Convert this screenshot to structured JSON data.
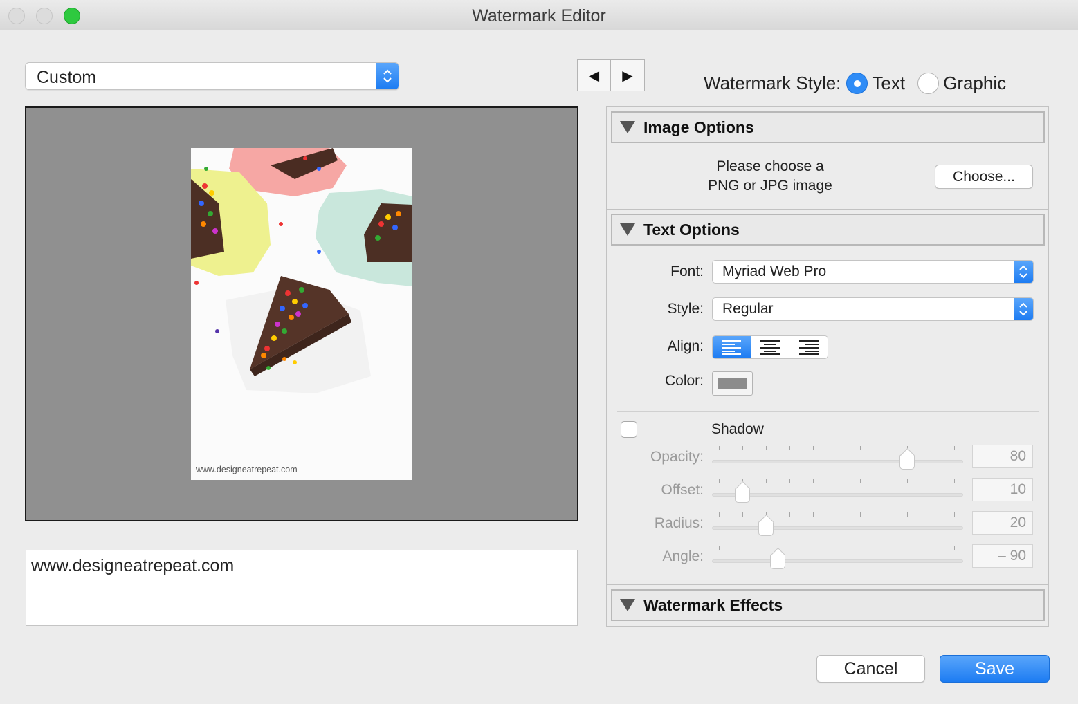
{
  "window": {
    "title": "Watermark Editor"
  },
  "preset": {
    "value": "Custom"
  },
  "nav": {
    "prev": "◀",
    "next": "▶"
  },
  "watermark_style": {
    "label": "Watermark Style:",
    "options": [
      {
        "label": "Text",
        "selected": true
      },
      {
        "label": "Graphic",
        "selected": false
      }
    ]
  },
  "preview": {
    "watermark_text": "www.designeatrepeat.com"
  },
  "text_input": {
    "value": "www.designeatrepeat.com"
  },
  "image_options": {
    "title": "Image Options",
    "prompt_line1": "Please choose a",
    "prompt_line2": "PNG or JPG image",
    "choose_label": "Choose..."
  },
  "text_options": {
    "title": "Text Options",
    "font_label": "Font:",
    "font_value": "Myriad Web Pro",
    "style_label": "Style:",
    "style_value": "Regular",
    "align_label": "Align:",
    "align_selected": "left",
    "color_label": "Color:",
    "color_value": "#8c8c8c"
  },
  "shadow": {
    "label": "Shadow",
    "enabled": false,
    "opacity_label": "Opacity:",
    "opacity_value": "80",
    "offset_label": "Offset:",
    "offset_value": "10",
    "radius_label": "Radius:",
    "radius_value": "20",
    "angle_label": "Angle:",
    "angle_value": "– 90"
  },
  "watermark_effects": {
    "title": "Watermark Effects"
  },
  "buttons": {
    "cancel": "Cancel",
    "save": "Save"
  },
  "colors": {
    "accent": "#2f8cf6",
    "preview_bg": "#909090"
  }
}
